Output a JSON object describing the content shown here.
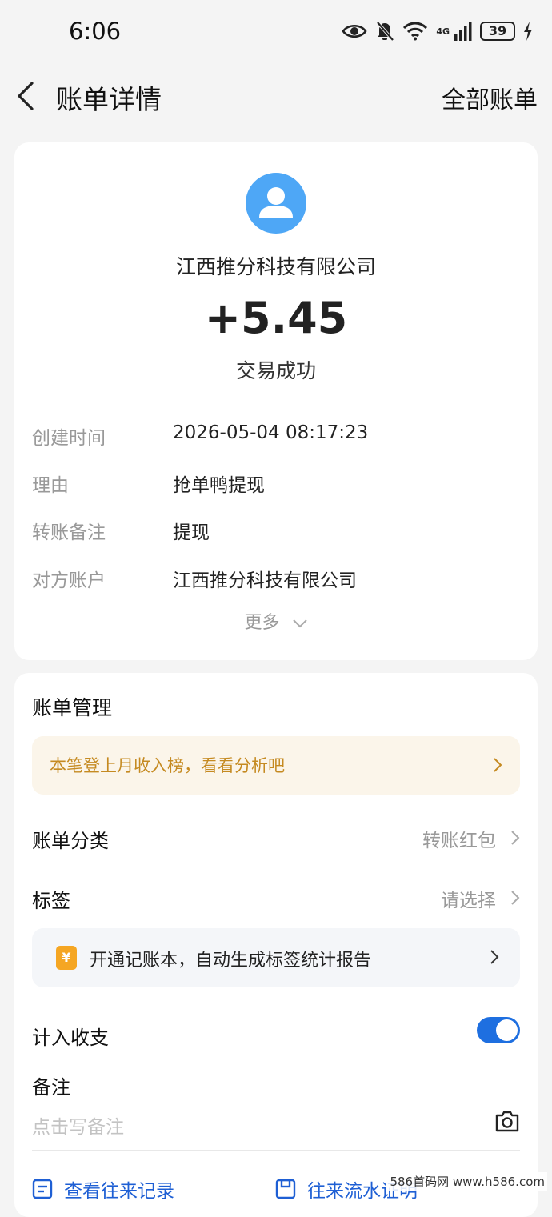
{
  "status_bar": {
    "time": "6:06",
    "network_label": "4G",
    "battery": "39"
  },
  "header": {
    "title": "账单详情",
    "right_link": "全部账单"
  },
  "transaction": {
    "payee": "江西推分科技有限公司",
    "amount": "+5.45",
    "status": "交易成功",
    "details": [
      {
        "label": "创建时间",
        "value": "2026-05-04 08:17:23"
      },
      {
        "label": "理由",
        "value": "抢单鸭提现"
      },
      {
        "label": "转账备注",
        "value": "提现"
      },
      {
        "label": "对方账户",
        "value": "江西推分科技有限公司"
      }
    ],
    "more_label": "更多"
  },
  "management": {
    "title": "账单管理",
    "promo_text": "本笔登上月收入榜，看看分析吧",
    "category_label": "账单分类",
    "category_value": "转账红包",
    "tag_label": "标签",
    "tag_value": "请选择",
    "ledger_icon": "¥",
    "ledger_text": "开通记账本，自动生成标签统计报告",
    "include_label": "计入收支",
    "include_enabled": true,
    "remark_label": "备注",
    "remark_placeholder": "点击写备注",
    "link_records": "查看往来记录",
    "link_statement": "往来流水证明"
  },
  "watermark": "586首码网 www.h586.com",
  "colors": {
    "accent": "#1e6fe0",
    "avatar": "#4ea7f6",
    "promo_text": "#c58a21",
    "ledger_icon": "#f5a623"
  }
}
